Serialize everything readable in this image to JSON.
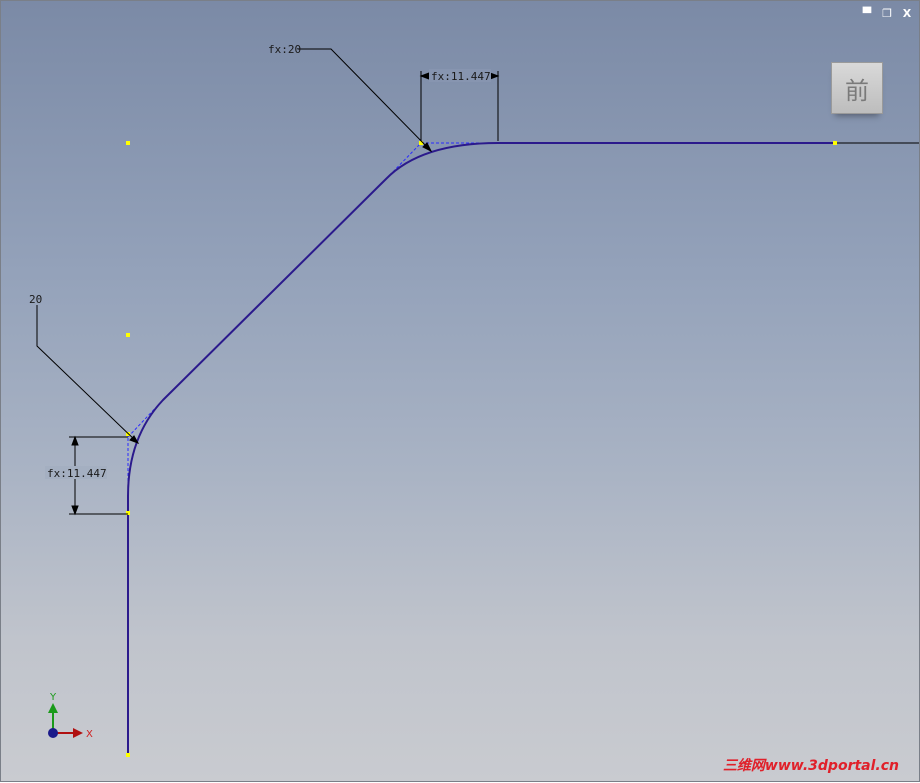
{
  "window": {
    "minimize_icon": "minimize-icon",
    "restore_icon": "restore-icon",
    "close_icon": "close-icon",
    "minimize_glyph": "▀",
    "restore_glyph": "❐",
    "close_glyph": "X"
  },
  "viewcube": {
    "face_label": "前"
  },
  "dimensions": {
    "top_radius": "fx:20",
    "top_length": "fx:11.447",
    "left_radius": "20",
    "left_length": "fx:11.447"
  },
  "triad": {
    "y_label": "Y",
    "x_label": "X"
  },
  "watermark": "三维网www.3dportal.cn",
  "colors": {
    "curve": "#2b1a8c",
    "construction": "#2a2aff",
    "point": "#ffff00",
    "dimension": "#000000"
  }
}
